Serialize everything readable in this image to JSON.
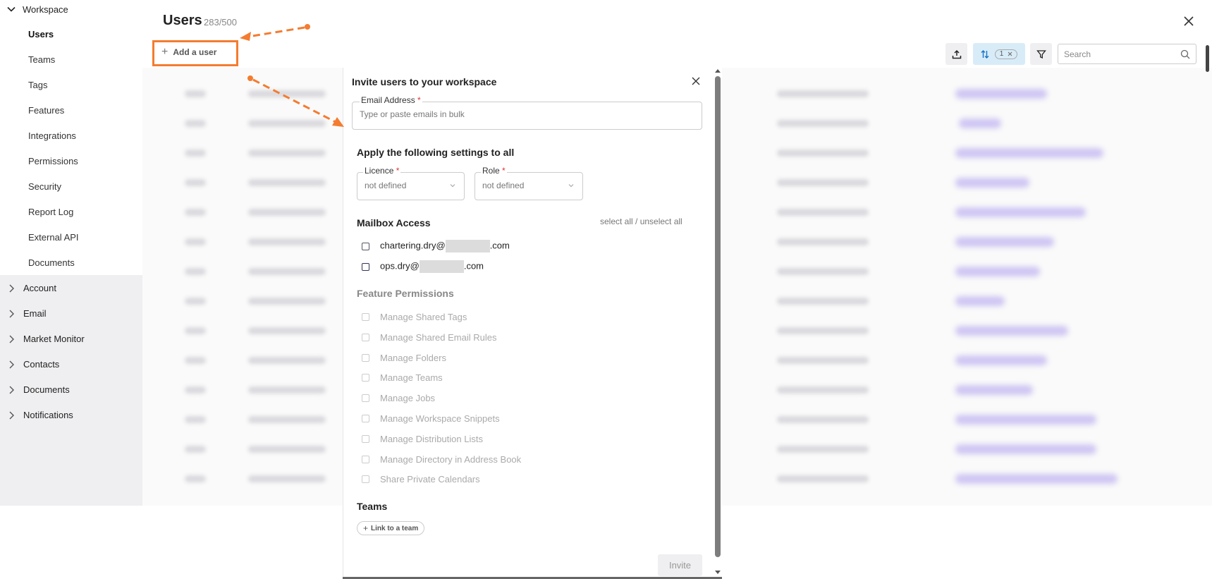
{
  "sidebar": {
    "workspace_label": "Workspace",
    "sub_items": [
      {
        "label": "Users",
        "active": true
      },
      {
        "label": "Teams"
      },
      {
        "label": "Tags"
      },
      {
        "label": "Features"
      },
      {
        "label": "Integrations"
      },
      {
        "label": "Permissions"
      },
      {
        "label": "Security"
      },
      {
        "label": "Report Log"
      },
      {
        "label": "External API"
      },
      {
        "label": "Documents"
      }
    ],
    "groups": [
      {
        "label": "Account"
      },
      {
        "label": "Email"
      },
      {
        "label": "Market Monitor"
      },
      {
        "label": "Contacts"
      },
      {
        "label": "Documents"
      },
      {
        "label": "Notifications"
      }
    ]
  },
  "header": {
    "title": "Users",
    "count": "283/500",
    "add_user_label": "Add a user",
    "sort_badge": "1",
    "search_placeholder": "Search"
  },
  "modal": {
    "title": "Invite users to your workspace",
    "email_label": "Email Address",
    "required_mark": "*",
    "email_placeholder": "Type or paste emails in bulk",
    "settings_title": "Apply the following settings to all",
    "licence_label": "Licence",
    "licence_value": "not defined",
    "role_label": "Role",
    "role_value": "not defined",
    "mailbox_title": "Mailbox Access",
    "select_all_label": "select all / unselect all",
    "mailboxes": [
      {
        "prefix": "chartering.dry@",
        "suffix": ".com"
      },
      {
        "prefix": "ops.dry@",
        "suffix": ".com"
      }
    ],
    "feature_title": "Feature Permissions",
    "features": [
      "Manage Shared Tags",
      "Manage Shared Email Rules",
      "Manage Folders",
      "Manage Teams",
      "Manage Jobs",
      "Manage Workspace Snippets",
      "Manage Distribution Lists",
      "Manage Directory in Address Book",
      "Share Private Calendars"
    ],
    "teams_title": "Teams",
    "link_team_label": "Link to a team",
    "invite_label": "Invite"
  },
  "colors": {
    "annotation": "#f47c30",
    "sort_active_bg": "#d8ecf8",
    "sidebar_group_bg": "#efeff1"
  }
}
